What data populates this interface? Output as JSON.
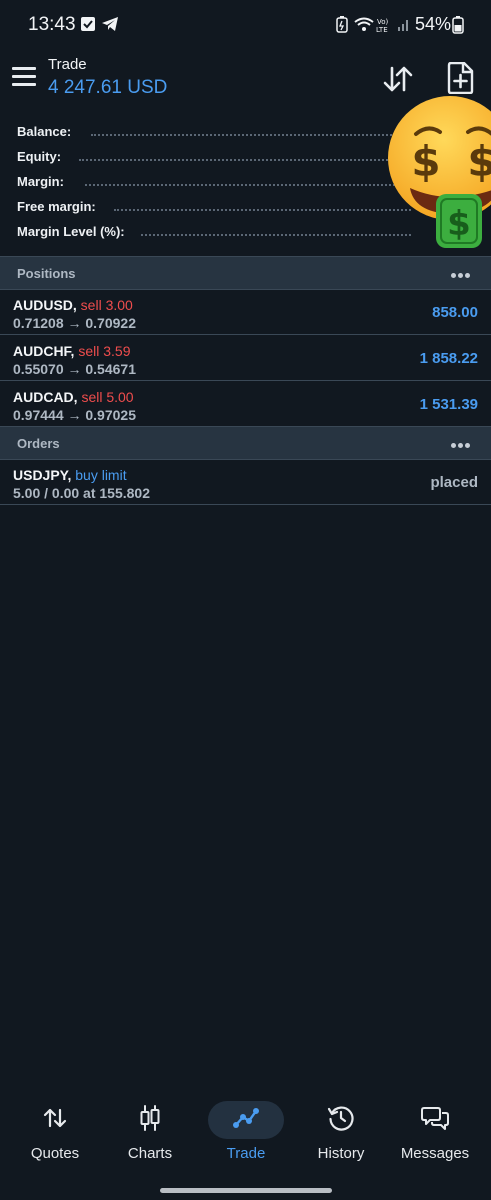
{
  "status_bar": {
    "time": "13:43",
    "battery": "54%",
    "icons": [
      "check-square-icon",
      "telegram-icon",
      "battery-saver-icon",
      "wifi-icon",
      "volte-icon",
      "signal-icon",
      "battery-icon"
    ]
  },
  "header": {
    "title": "Trade",
    "balance_display": "4 247.61 USD",
    "icons": [
      "menu-icon",
      "sort-icon",
      "new-order-icon"
    ]
  },
  "summary": {
    "rows": [
      {
        "label": "Balance:"
      },
      {
        "label": "Equity:"
      },
      {
        "label": "Margin:"
      },
      {
        "label": "Free margin:"
      },
      {
        "label": "Margin Level (%):"
      }
    ],
    "overlay": "money-mouth-face-emoji"
  },
  "positions": {
    "title": "Positions",
    "items": [
      {
        "symbol": "AUDUSD,",
        "action": "sell 3.00",
        "prices": "0.71208 → 0.70922",
        "profit": "858.00"
      },
      {
        "symbol": "AUDCHF,",
        "action": "sell 3.59",
        "prices": "0.55070 → 0.54671",
        "profit": "1 858.22"
      },
      {
        "symbol": "AUDCAD,",
        "action": "sell 5.00",
        "prices": "0.97444 → 0.97025",
        "profit": "1 531.39"
      }
    ]
  },
  "orders": {
    "title": "Orders",
    "items": [
      {
        "symbol": "USDJPY,",
        "action": "buy limit",
        "details": "5.00 / 0.00 at 155.802",
        "state": "placed"
      }
    ]
  },
  "bottom_nav": {
    "items": [
      {
        "label": "Quotes",
        "icon": "quotes-icon"
      },
      {
        "label": "Charts",
        "icon": "charts-icon"
      },
      {
        "label": "Trade",
        "icon": "trade-icon",
        "active": true
      },
      {
        "label": "History",
        "icon": "history-icon"
      },
      {
        "label": "Messages",
        "icon": "messages-icon"
      }
    ]
  },
  "colors": {
    "background": "#111820",
    "accent": "#4a9cf0",
    "sell": "#ef4d4d",
    "section_bg": "#273441"
  }
}
